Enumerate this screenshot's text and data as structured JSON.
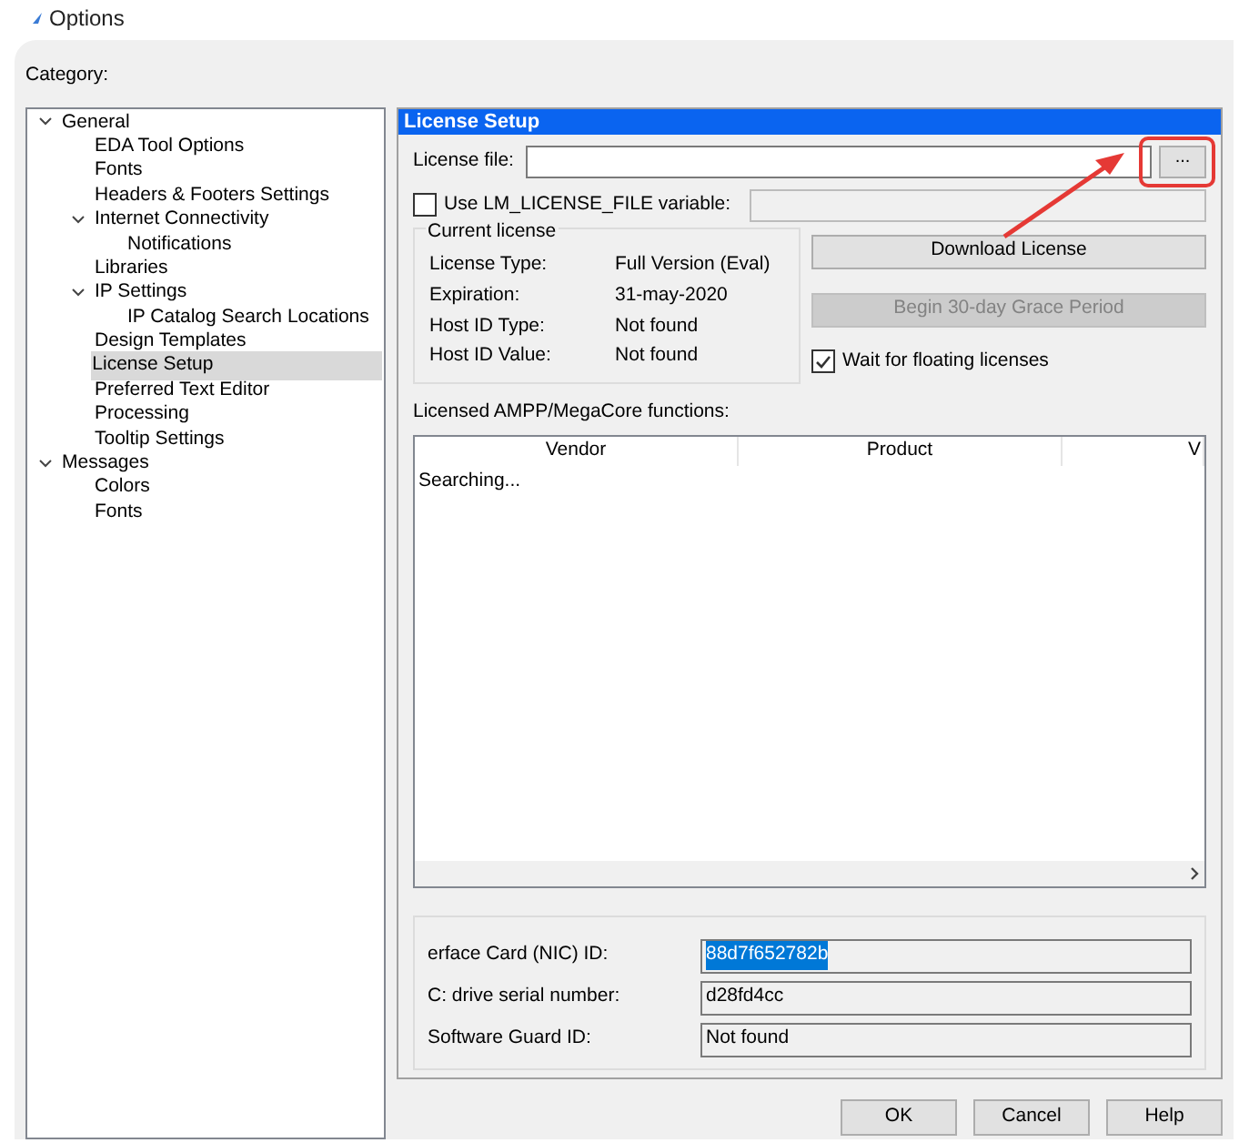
{
  "window": {
    "title": "Options"
  },
  "category_label": "Category:",
  "tree": [
    {
      "label": "General",
      "expanded": true,
      "selected": false,
      "children": [
        {
          "label": "EDA Tool Options",
          "selected": false
        },
        {
          "label": "Fonts",
          "selected": false
        },
        {
          "label": "Headers & Footers Settings",
          "selected": false
        },
        {
          "label": "Internet Connectivity",
          "expanded": true,
          "selected": false,
          "children": [
            {
              "label": "Notifications",
              "selected": false
            }
          ]
        },
        {
          "label": "Libraries",
          "selected": false
        },
        {
          "label": "IP Settings",
          "expanded": true,
          "selected": false,
          "children": [
            {
              "label": "IP Catalog Search Locations",
              "selected": false
            }
          ]
        },
        {
          "label": "Design Templates",
          "selected": false
        },
        {
          "label": "License Setup",
          "selected": true
        },
        {
          "label": "Preferred Text Editor",
          "selected": false
        },
        {
          "label": "Processing",
          "selected": false
        },
        {
          "label": "Tooltip Settings",
          "selected": false
        }
      ]
    },
    {
      "label": "Messages",
      "expanded": true,
      "selected": false,
      "children": [
        {
          "label": "Colors",
          "selected": false
        },
        {
          "label": "Fonts",
          "selected": false
        }
      ]
    }
  ],
  "panel": {
    "title": "License Setup",
    "license_file": {
      "label": "License file:",
      "browse": "..."
    },
    "lm_variable": {
      "label": "Use LM_LICENSE_FILE variable:",
      "checked": false
    },
    "current_license": {
      "title": "Current license",
      "rows": [
        {
          "label": "License Type:",
          "value": "Full Version (Eval)"
        },
        {
          "label": "Expiration:",
          "value": "31-may-2020"
        },
        {
          "label": "Host ID Type:",
          "value": "Not found"
        },
        {
          "label": "Host ID Value:",
          "value": "Not found"
        }
      ]
    },
    "download_button": {
      "label": "Download License",
      "disabled": false
    },
    "grace_button": {
      "label": "Begin 30-day Grace Period",
      "disabled": true
    },
    "wait_floating": {
      "label": "Wait for floating licenses",
      "checked": true
    },
    "functions_label": "Licensed AMPP/MegaCore functions:",
    "table": {
      "columns": [
        "Vendor",
        "Product",
        "V"
      ],
      "status": "Searching..."
    },
    "ids": [
      {
        "label": "erface Card (NIC) ID:",
        "value": "88d7f652782b",
        "selected": true
      },
      {
        "label": "C: drive serial number:",
        "value": "d28fd4cc",
        "selected": false
      },
      {
        "label": "Software Guard ID:",
        "value": "Not found",
        "selected": false
      }
    ]
  },
  "buttons": [
    "OK",
    "Cancel",
    "Help"
  ]
}
